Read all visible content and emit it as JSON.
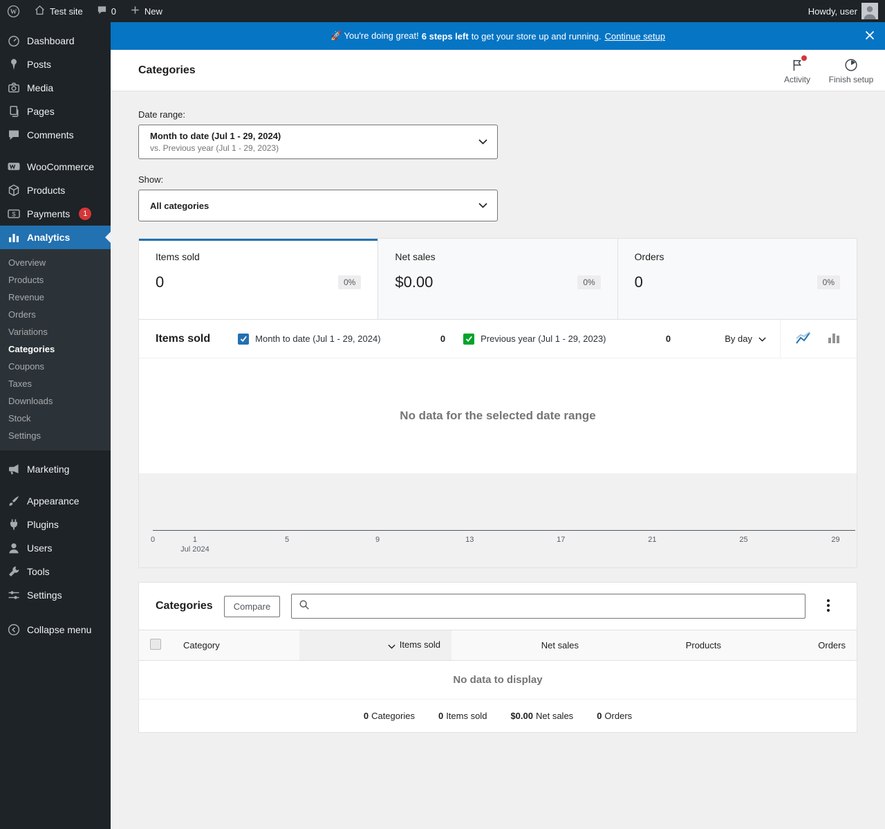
{
  "colors": {
    "accent": "#2271b1",
    "banner": "#0675c4",
    "badge_red": "#d63638",
    "series_primary": "#2271b1",
    "series_secondary": "#00a32a"
  },
  "admin_bar": {
    "site_name": "Test site",
    "comments_count": "0",
    "new_label": "New",
    "howdy": "Howdy, user"
  },
  "sidebar": {
    "items_top": [
      {
        "label": "Dashboard"
      },
      {
        "label": "Posts"
      },
      {
        "label": "Media"
      },
      {
        "label": "Pages"
      },
      {
        "label": "Comments"
      }
    ],
    "items_commerce": [
      {
        "label": "WooCommerce"
      },
      {
        "label": "Products"
      },
      {
        "label": "Payments",
        "badge": "1"
      },
      {
        "label": "Analytics"
      }
    ],
    "analytics_submenu": [
      {
        "label": "Overview"
      },
      {
        "label": "Products"
      },
      {
        "label": "Revenue"
      },
      {
        "label": "Orders"
      },
      {
        "label": "Variations"
      },
      {
        "label": "Categories"
      },
      {
        "label": "Coupons"
      },
      {
        "label": "Taxes"
      },
      {
        "label": "Downloads"
      },
      {
        "label": "Stock"
      },
      {
        "label": "Settings"
      }
    ],
    "marketing_label": "Marketing",
    "items_bottom": [
      {
        "label": "Appearance"
      },
      {
        "label": "Plugins"
      },
      {
        "label": "Users"
      },
      {
        "label": "Tools"
      },
      {
        "label": "Settings"
      }
    ],
    "collapse_label": "Collapse menu"
  },
  "banner": {
    "message_prefix": "🚀 You're doing great!",
    "steps_left": "6 steps left",
    "message_suffix": "to get your store up and running.",
    "link_label": "Continue setup"
  },
  "header": {
    "title": "Categories",
    "activity_label": "Activity",
    "finish_setup_label": "Finish setup"
  },
  "filters": {
    "date_range_label": "Date range:",
    "date_range_value": "Month to date (Jul 1 - 29, 2024)",
    "date_range_compare": "vs. Previous year (Jul 1 - 29, 2023)",
    "show_label": "Show:",
    "show_value": "All categories"
  },
  "stats": [
    {
      "label": "Items sold",
      "value": "0",
      "delta": "0%"
    },
    {
      "label": "Net sales",
      "value": "$0.00",
      "delta": "0%"
    },
    {
      "label": "Orders",
      "value": "0",
      "delta": "0%"
    }
  ],
  "chart": {
    "title": "Items sold",
    "legend": [
      {
        "label": "Month to date (Jul 1 - 29, 2024)",
        "value": "0"
      },
      {
        "label": "Previous year (Jul 1 - 29, 2023)",
        "value": "0"
      }
    ],
    "interval_label": "By day",
    "empty_message": "No data for the selected date range",
    "x_ticks": [
      "0",
      "1",
      "5",
      "9",
      "13",
      "17",
      "21",
      "25",
      "29"
    ],
    "x_axis_sublabel": "Jul 2024"
  },
  "table": {
    "title": "Categories",
    "compare_label": "Compare",
    "columns": [
      "Category",
      "Items sold",
      "Net sales",
      "Products",
      "Orders"
    ],
    "empty_message": "No data to display",
    "summary": [
      {
        "value": "0",
        "label": "Categories"
      },
      {
        "value": "0",
        "label": "Items sold"
      },
      {
        "value": "$0.00",
        "label": "Net sales"
      },
      {
        "value": "0",
        "label": "Orders"
      }
    ]
  }
}
